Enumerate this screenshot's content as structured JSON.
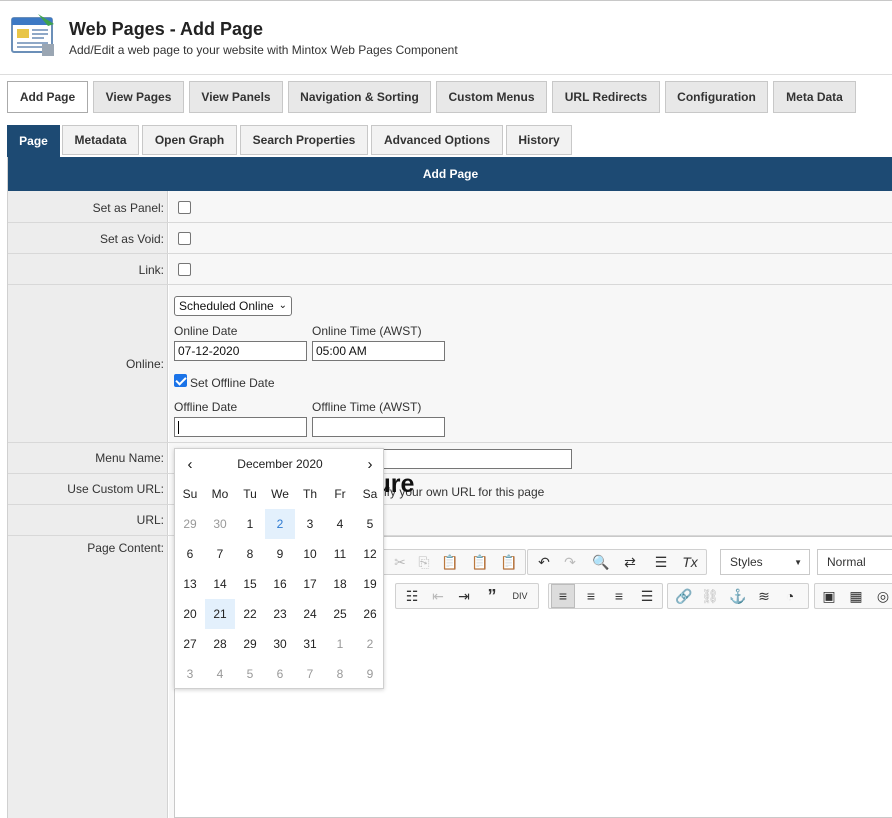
{
  "header": {
    "title": "Web Pages - Add Page",
    "subtitle": "Add/Edit a web page to your website with Mintox Web Pages Component"
  },
  "main_nav": [
    {
      "label": "Add Page",
      "active": true
    },
    {
      "label": "View Pages"
    },
    {
      "label": "View Panels"
    },
    {
      "label": "Navigation & Sorting"
    },
    {
      "label": "Custom Menus"
    },
    {
      "label": "URL Redirects"
    },
    {
      "label": "Configuration"
    },
    {
      "label": "Meta Data"
    }
  ],
  "tabs": [
    {
      "label": "Page",
      "active": true
    },
    {
      "label": "Metadata"
    },
    {
      "label": "Open Graph"
    },
    {
      "label": "Search Properties"
    },
    {
      "label": "Advanced Options"
    },
    {
      "label": "History"
    }
  ],
  "form": {
    "heading": "Add Page",
    "set_as_panel": {
      "label": "Set as Panel:",
      "checked": false
    },
    "set_as_void": {
      "label": "Set as Void:",
      "checked": false
    },
    "link": {
      "label": "Link:",
      "checked": false
    },
    "online": {
      "label": "Online:",
      "mode": "Scheduled Online",
      "online_date_label": "Online Date",
      "online_date": "07-12-2020",
      "online_time_label": "Online Time (AWST)",
      "online_time": "05:00 AM",
      "set_offline_label": "Set Offline Date",
      "set_offline_checked": true,
      "offline_date_label": "Offline Date",
      "offline_date": "",
      "offline_time_label": "Offline Time (AWST)",
      "offline_time": ""
    },
    "menu_name": {
      "label": "Menu Name:",
      "value": ""
    },
    "use_custom_url": {
      "label": "Use Custom URL:",
      "hint": "ify your own URL for this page"
    },
    "url": {
      "label": "URL:"
    },
    "page_content": {
      "label": "Page Content:",
      "heading_text": "heduling Feature"
    }
  },
  "editor_toolbar": {
    "styles_label": "Styles",
    "format_label": "Normal"
  },
  "calendar": {
    "month_label": "December 2020",
    "prev": "‹",
    "next": "›",
    "weekdays": [
      "Su",
      "Mo",
      "Tu",
      "We",
      "Th",
      "Fr",
      "Sa"
    ],
    "weeks": [
      [
        "29",
        "30",
        "1",
        "2",
        "3",
        "4",
        "5"
      ],
      [
        "6",
        "7",
        "8",
        "9",
        "10",
        "11",
        "12"
      ],
      [
        "13",
        "14",
        "15",
        "16",
        "17",
        "18",
        "19"
      ],
      [
        "20",
        "21",
        "22",
        "23",
        "24",
        "25",
        "26"
      ],
      [
        "27",
        "28",
        "29",
        "30",
        "31",
        "1",
        "2"
      ],
      [
        "3",
        "4",
        "5",
        "6",
        "7",
        "8",
        "9"
      ]
    ],
    "selected_day": "2",
    "today_day": "21",
    "colors": {
      "selected_bg": "#e3f0fc",
      "selected_text": "#2e7ad1"
    }
  },
  "colors": {
    "accent": "#1d4a73"
  }
}
